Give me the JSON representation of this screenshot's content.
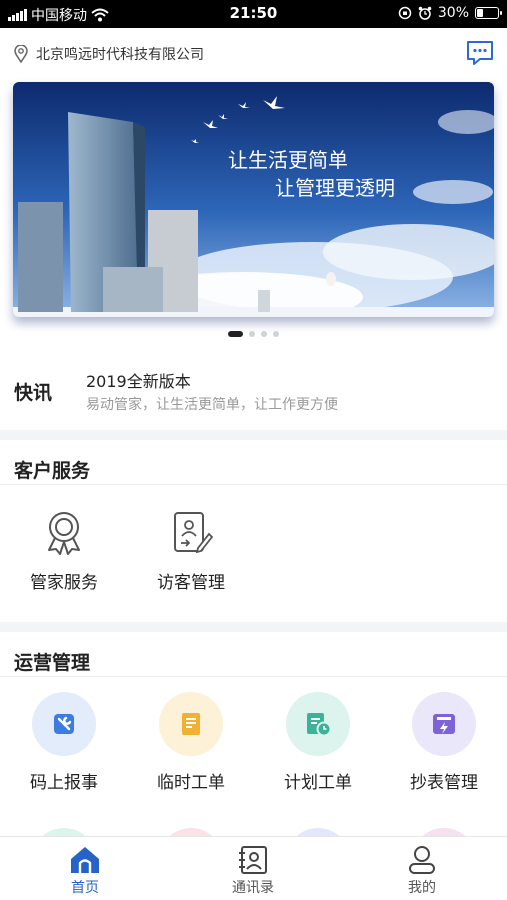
{
  "status_bar": {
    "carrier": "中国移动",
    "time": "21:50",
    "battery": "30%",
    "battery_level": 0.3
  },
  "header": {
    "location": "北京鸣远时代科技有限公司",
    "message_icon": "chat-bubble-icon"
  },
  "banner": {
    "line1": "让生活更简单",
    "line2": "让管理更透明",
    "page_count": 4,
    "active_page": 0
  },
  "news": {
    "label": "快讯",
    "headline": "2019全新版本",
    "summary": "易动管家，让生活更简单，让工作更方便"
  },
  "customer_service": {
    "title": "客户服务",
    "items": [
      {
        "label": "管家服务",
        "icon": "medal-icon"
      },
      {
        "label": "访客管理",
        "icon": "visitor-card-icon"
      }
    ]
  },
  "operations": {
    "title": "运营管理",
    "items": [
      {
        "label": "码上报事",
        "icon": "wrench-icon",
        "bg": "#e3ecfb",
        "color": "#3d7be0"
      },
      {
        "label": "临时工单",
        "icon": "document-icon",
        "bg": "#fdf1d8",
        "color": "#f1b233"
      },
      {
        "label": "计划工单",
        "icon": "clock-document-icon",
        "bg": "#dcf3ee",
        "color": "#3bb39a"
      },
      {
        "label": "抄表管理",
        "icon": "meter-icon",
        "bg": "#ebe7fa",
        "color": "#7e63d6"
      }
    ]
  },
  "bottom_nav": {
    "tabs": [
      {
        "label": "首页",
        "icon": "home-icon",
        "active": true
      },
      {
        "label": "通讯录",
        "icon": "contacts-icon",
        "active": false
      },
      {
        "label": "我的",
        "icon": "profile-icon",
        "active": false
      }
    ]
  },
  "colors": {
    "accent": "#2563c8",
    "page_bg": "#f3f4f6"
  }
}
